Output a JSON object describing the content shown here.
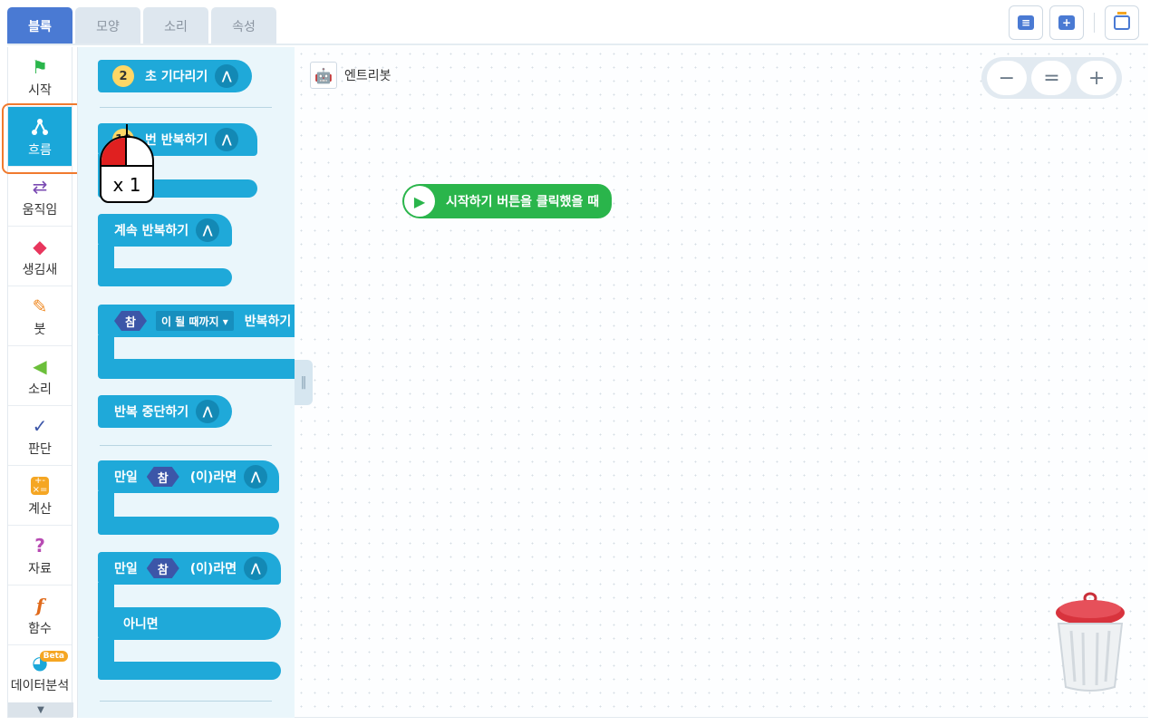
{
  "tabs": [
    "블록",
    "모양",
    "소리",
    "속성"
  ],
  "categories": [
    {
      "label": "시작",
      "icon": "flag-icon"
    },
    {
      "label": "흐름",
      "icon": "flow-icon"
    },
    {
      "label": "움직임",
      "icon": "move-arrows-icon"
    },
    {
      "label": "생김새",
      "icon": "shapes-icon"
    },
    {
      "label": "붓",
      "icon": "brush-icon"
    },
    {
      "label": "소리",
      "icon": "speaker-icon"
    },
    {
      "label": "판단",
      "icon": "check-icon"
    },
    {
      "label": "계산",
      "icon": "calculator-icon"
    },
    {
      "label": "자료",
      "icon": "question-icon"
    },
    {
      "label": "함수",
      "icon": "function-icon"
    },
    {
      "label": "데이터분석",
      "icon": "pie-chart-icon",
      "badge": "Beta"
    }
  ],
  "blocks": {
    "wait": {
      "num": "2",
      "text": "초 기다리기"
    },
    "repeat": {
      "num": "10",
      "text": "번 반복하기"
    },
    "forever": {
      "text": "계속 반복하기"
    },
    "repeat_until": {
      "bool": "참",
      "dropdown": "이 될 때까지 ▾",
      "text": "반복하기"
    },
    "stop_repeat": {
      "text": "반복 중단하기"
    },
    "if": {
      "prefix": "만일",
      "bool": "참",
      "suffix": "(이)라면"
    },
    "if_else": {
      "prefix": "만일",
      "bool": "참",
      "suffix": "(이)라면",
      "else": "아니면"
    }
  },
  "canvas": {
    "object_name": "엔트리봇",
    "start_block": "시작하기 버튼을 클릭했을 때",
    "zoom_out": "−",
    "zoom_reset": "=",
    "zoom_in": "+"
  },
  "mouse_overlay": {
    "clicks": "x 1"
  }
}
